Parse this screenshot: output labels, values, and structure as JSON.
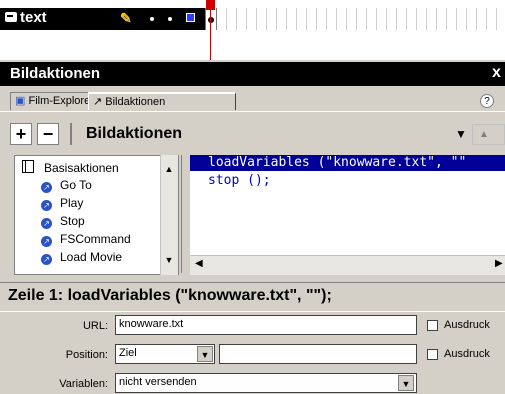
{
  "timeline": {
    "layer_name": "text"
  },
  "panel": {
    "title": "Bildaktionen",
    "close_label": "x"
  },
  "tabs": [
    {
      "label": "Film-Explorer"
    },
    {
      "label": "Bildaktionen"
    }
  ],
  "help_label": "?",
  "toolbar": {
    "plus_label": "+",
    "minus_label": "−",
    "actions_label": "Bildaktionen"
  },
  "action_tree": {
    "category": "Basisaktionen",
    "items": [
      "Go To",
      "Play",
      "Stop",
      "FSCommand",
      "Load Movie"
    ]
  },
  "code": {
    "line1": "loadVariables (\"knowware.txt\", \"\"",
    "line2": "stop ();"
  },
  "status_line": "Zeile 1: loadVariables (\"knowware.txt\", \"\");",
  "form": {
    "url_label": "URL:",
    "url_value": "knowware.txt",
    "url_expr_label": "Ausdruck",
    "position_label": "Position:",
    "position_value": "Ziel",
    "position_input": "",
    "position_expr_label": "Ausdruck",
    "variables_label": "Variablen:",
    "variables_value": "nicht versenden"
  },
  "colors": {
    "selection": "#000099",
    "code_text": "#0000cc",
    "keyword_icon": "#2c52c8",
    "playhead": "#cc0000"
  }
}
